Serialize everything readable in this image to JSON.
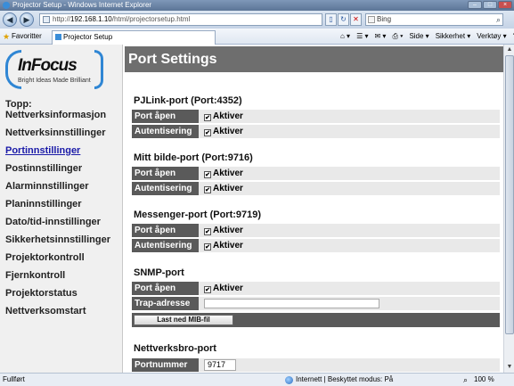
{
  "window": {
    "title": "Projector Setup - Windows Internet Explorer",
    "controls": [
      "–",
      "□",
      "×"
    ]
  },
  "addressbar": {
    "back": "◀",
    "forward": "▶",
    "url_host": "192.168.1.10",
    "url_path": "/html/projectorsetup.html",
    "compat": "▯",
    "refresh": "↻",
    "stop": "✕",
    "search_value": "Bing",
    "search_icon": "⌕"
  },
  "favbar": {
    "favorites_label": "Favoritter",
    "tab_title": "Projector Setup",
    "commands": [
      "⌂ ▾",
      "☰ ▾",
      "✉ ▾",
      "⎙ ▾",
      "Side ▾",
      "Sikkerhet ▾",
      "Verktøy ▾",
      "? ▾"
    ]
  },
  "logo": {
    "brand": "InFocus",
    "tagline": "Bright Ideas Made Brilliant"
  },
  "sidebar": {
    "items": [
      {
        "label": "Topp:"
      },
      {
        "label": "Nettverksinformasjon"
      },
      {
        "label": "Nettverksinnstillinger"
      },
      {
        "label": "Portinnstillinger",
        "active": true
      },
      {
        "label": "Postinnstillinger"
      },
      {
        "label": "Alarminnstillinger"
      },
      {
        "label": "Planinnstillinger"
      },
      {
        "label": "Dato/tid-innstillinger"
      },
      {
        "label": "Sikkerhetsinnstillinger"
      },
      {
        "label": "Projektorkontroll"
      },
      {
        "label": "Fjernkontroll"
      },
      {
        "label": "Projektorstatus"
      },
      {
        "label": "Nettverksomstart"
      }
    ]
  },
  "page": {
    "title": "Port Settings"
  },
  "sections": {
    "pjlink": {
      "title": "PJLink-port (Port:4352)",
      "port_open_label": "Port åpen",
      "port_open_value": "Aktiver",
      "auth_label": "Autentisering",
      "auth_value": "Aktiver"
    },
    "mypicture": {
      "title": "Mitt bilde-port (Port:9716)",
      "port_open_label": "Port åpen",
      "port_open_value": "Aktiver",
      "auth_label": "Autentisering",
      "auth_value": "Aktiver"
    },
    "messenger": {
      "title": "Messenger-port (Port:9719)",
      "port_open_label": "Port åpen",
      "port_open_value": "Aktiver",
      "auth_label": "Autentisering",
      "auth_value": "Aktiver"
    },
    "snmp": {
      "title": "SNMP-port",
      "port_open_label": "Port åpen",
      "port_open_value": "Aktiver",
      "trap_label": "Trap-adresse",
      "trap_value": "",
      "mib_button": "Last ned MIB-fil"
    },
    "bridge": {
      "title": "Nettverksbro-port",
      "port_label": "Portnummer",
      "port_value": "9717"
    }
  },
  "checkbox_glyph": "✔",
  "scrollbar": {
    "up": "▲",
    "down": "▼"
  },
  "statusbar": {
    "left": "Fullført",
    "zone": "Internett | Beskyttet modus: På",
    "zoom": "100 %",
    "zoom_icon": "⌕"
  }
}
